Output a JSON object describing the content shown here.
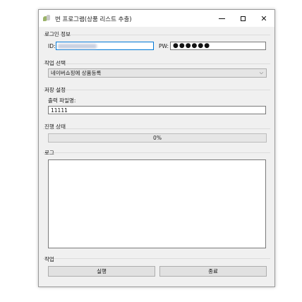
{
  "window": {
    "title": "번 프로그램(상품 리스트 추출)"
  },
  "login": {
    "section_label": "로그인 정보",
    "id_label": "ID:",
    "id_value": "",
    "pw_label": "PW:",
    "pw_value": "●●●●●●"
  },
  "task": {
    "section_label": "작업 선택",
    "selected": "네이버쇼핑에 상품등록"
  },
  "save": {
    "section_label": "저장 설정",
    "filename_label": "출력 파일명:",
    "filename_value": "11111"
  },
  "progress": {
    "section_label": "진행 상태",
    "percent_text": "0%",
    "value": 0
  },
  "log": {
    "section_label": "로그",
    "content": ""
  },
  "actions": {
    "section_label": "작업",
    "run_label": "실행",
    "exit_label": "종료"
  },
  "icons": {
    "app": "app-icon",
    "minimize": "minimize-icon",
    "maximize": "maximize-icon",
    "close": "close-icon",
    "dropdown": "chevron-down-icon"
  }
}
